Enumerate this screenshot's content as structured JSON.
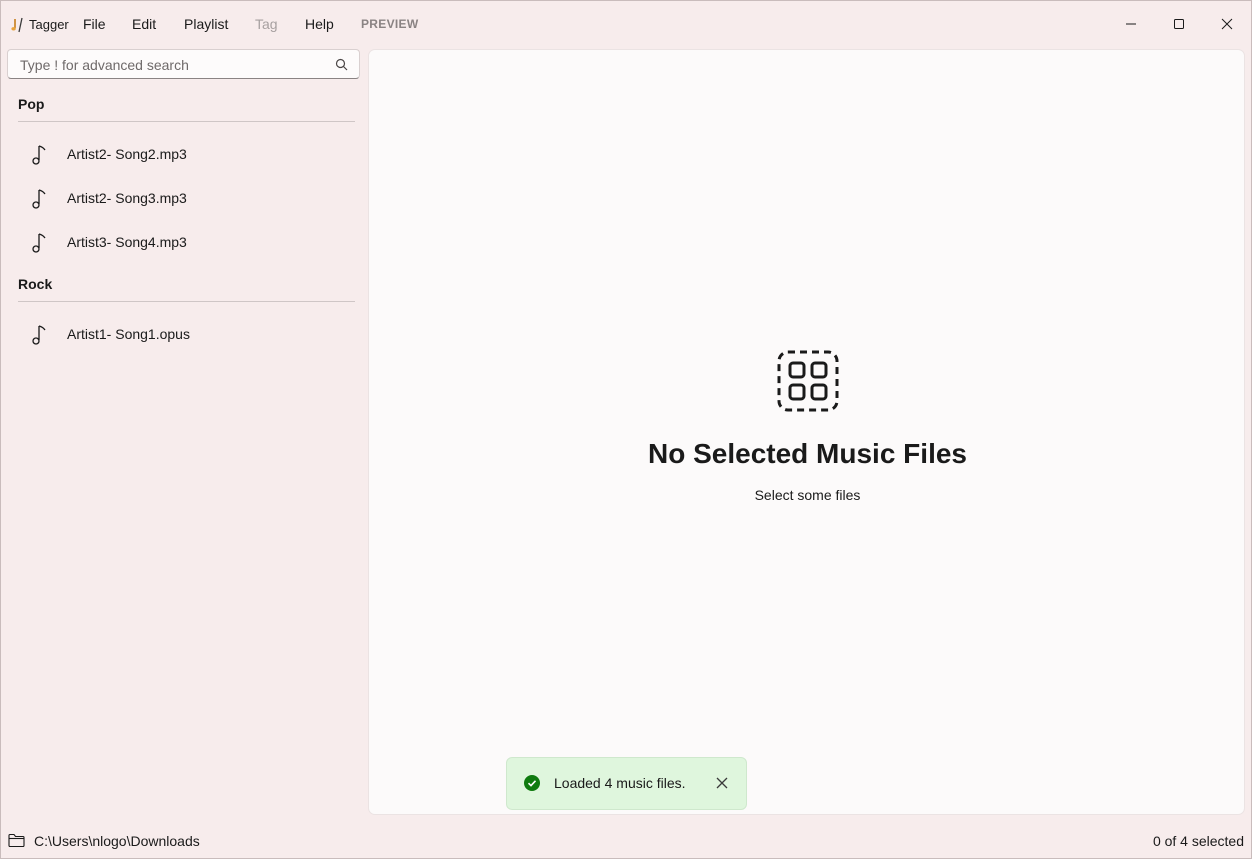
{
  "app": {
    "title": "Tagger"
  },
  "menu": {
    "file": "File",
    "edit": "Edit",
    "playlist": "Playlist",
    "tag": "Tag",
    "help": "Help",
    "preview": "PREVIEW"
  },
  "search": {
    "placeholder": "Type ! for advanced search",
    "value": ""
  },
  "groups": [
    {
      "name": "Pop",
      "items": [
        "Artist2- Song2.mp3",
        "Artist2- Song3.mp3",
        "Artist3- Song4.mp3"
      ]
    },
    {
      "name": "Rock",
      "items": [
        "Artist1- Song1.opus"
      ]
    }
  ],
  "main": {
    "empty_title": "No Selected Music Files",
    "empty_subtitle": "Select some files"
  },
  "toast": {
    "message": "Loaded 4 music files."
  },
  "status": {
    "path": "C:\\Users\\nlogo\\Downloads",
    "selection": "0 of 4 selected"
  },
  "colors": {
    "background": "#f7ecec",
    "panel": "#fcfafa",
    "toast_bg": "#dff6dd",
    "success": "#0f7b0f"
  }
}
